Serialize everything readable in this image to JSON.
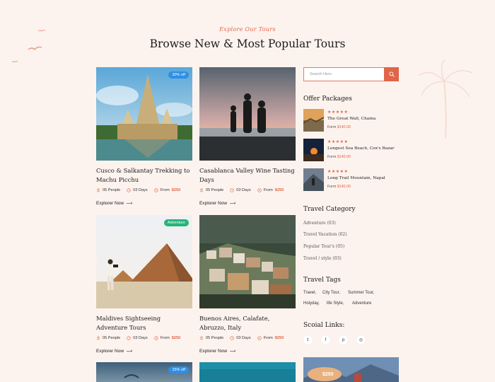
{
  "header": {
    "eyebrow": "Explore Our Tours",
    "title": "Browse New & Most Popular Tours"
  },
  "tours": [
    {
      "title": "Cusco & Salkantay Trekking to Machu Picchu",
      "people": "05 People",
      "days": "03 Days",
      "from_label": "From",
      "price": "$250",
      "badge": "30% off",
      "explore": "Explorer Now"
    },
    {
      "title": "Casablanca Valley Wine Tasting Days",
      "people": "05 People",
      "days": "03 Days",
      "from_label": "From",
      "price": "$250",
      "explore": "Explorer Now"
    },
    {
      "title": "Maldives Sightseeing Adventure Tours",
      "people": "05 People",
      "days": "03 Days",
      "from_label": "From",
      "price": "$250",
      "badge": "Adventure",
      "explore": "Explorer Now"
    },
    {
      "title": "Buenos Aires, Calafate, Abruzzo, Italy",
      "people": "05 People",
      "days": "03 Days",
      "from_label": "From",
      "price": "$250",
      "explore": "Explorer Now"
    },
    {
      "badge": "15% off"
    }
  ],
  "sidebar": {
    "search_placeholder": "Search Here",
    "offer_heading": "Offer Packages",
    "packages": [
      {
        "name": "The Great Wall, Chaina",
        "from_label": "Form",
        "price": "$140.00",
        "stars": "★★★★★"
      },
      {
        "name": "Longest Sea Beach, Cox's Bazar",
        "from_label": "Form",
        "price": "$140.00",
        "stars": "★★★★★"
      },
      {
        "name": "Long Trail Mountain, Napal",
        "from_label": "Form",
        "price": "$140.00",
        "stars": "★★★★★"
      }
    ],
    "category_heading": "Travel Category",
    "categories": [
      "Adventure (03)",
      "Travel Vacation (02)",
      "Popular Tour's (05)",
      "Travel / style (03)"
    ],
    "tags_heading": "Travel Tags",
    "tags": [
      "Travel,",
      "City Tour,",
      "Summer Tour,",
      "Holyday,",
      "life Style,",
      "Adventure"
    ],
    "social_heading": "Scoial Links:",
    "social_icons": [
      "twitter-icon",
      "facebook-icon",
      "pinterest-icon",
      "instagram-icon"
    ],
    "promo_price": "$250"
  },
  "colors": {
    "accent": "#e0654a",
    "background": "#fdf3ee",
    "badge_blue": "#2f8ee5",
    "badge_green": "#27b37a"
  }
}
